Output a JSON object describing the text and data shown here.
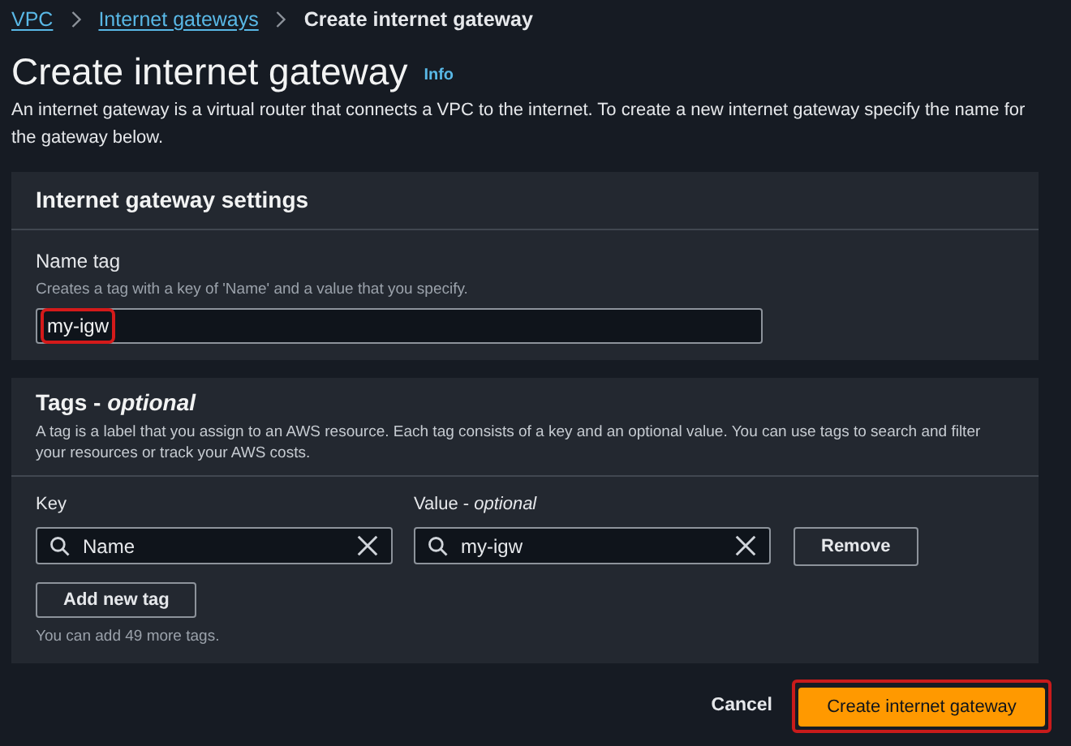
{
  "breadcrumb": [
    {
      "label": "VPC",
      "link": true
    },
    {
      "label": "Internet gateways",
      "link": true
    },
    {
      "label": "Create internet gateway",
      "link": false
    }
  ],
  "page": {
    "title": "Create internet gateway",
    "info": "Info",
    "description": "An internet gateway is a virtual router that connects a VPC to the internet. To create a new internet gateway specify the name for the gateway below."
  },
  "settings": {
    "title": "Internet gateway settings",
    "field_label": "Name tag",
    "field_hint": "Creates a tag with a key of 'Name' and a value that you specify.",
    "value": "my-igw",
    "highlighted": true
  },
  "tags": {
    "title": "Tags - *optional*",
    "description": "A tag is a label that you assign to an AWS resource. Each tag consists of a key and an optional value. You can use tags to search and filter your resources or track your AWS costs.",
    "key_label": "Key",
    "value_label": "Value - *optional*",
    "rows": [
      {
        "key": "Name",
        "value": "my-igw",
        "remove": "Remove"
      }
    ],
    "add_button": "Add new tag",
    "limit_note": "You can add 49 more tags."
  },
  "actions": {
    "cancel": "Cancel",
    "submit": "Create internet gateway",
    "submit_highlighted": true
  }
}
